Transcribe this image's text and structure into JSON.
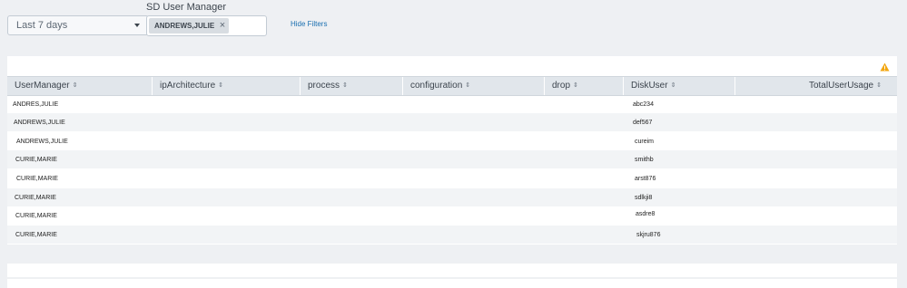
{
  "filters": {
    "time_range": "Last 7 days",
    "user_manager_label": "SD User Manager",
    "selected_token": "ANDREWS,JULIE",
    "remove_token_glyph": "×",
    "hide_filters": "Hide Filters"
  },
  "table": {
    "columns": [
      "UserManager",
      "ipArchitecture",
      "process",
      "configuration",
      "drop",
      "DiskUser",
      "TotalUserUsage"
    ],
    "sort_glyph": "⇕",
    "rows": [
      {
        "user_manager": "ANDRES,JULIE",
        "disk_user": "abc234"
      },
      {
        "user_manager": "ANDREWS,JULIE",
        "disk_user": "def567"
      },
      {
        "user_manager": "ANDREWS,JULIE",
        "disk_user": "cureim"
      },
      {
        "user_manager": "CURIE,MARIE",
        "disk_user": "smithb"
      },
      {
        "user_manager": "CURIE,MARIE",
        "disk_user": "arst876"
      },
      {
        "user_manager": "CURIE,MARIE",
        "disk_user": "sdlkji8"
      },
      {
        "user_manager": "CURIE,MARIE",
        "disk_user": "asdre8"
      },
      {
        "user_manager": "CURIE,MARIE",
        "disk_user": "skjru876"
      }
    ]
  },
  "colors": {
    "warning": "#f2a60f",
    "link": "#1a6fb0",
    "header_bg": "#e1e6eb"
  }
}
